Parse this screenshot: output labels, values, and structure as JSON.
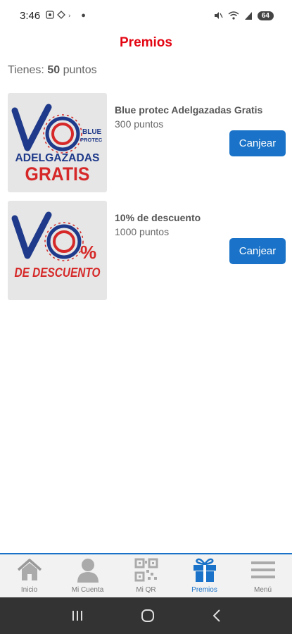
{
  "status": {
    "time": "3:46",
    "battery": "64"
  },
  "header": {
    "title": "Premios"
  },
  "points": {
    "prefix": "Tienes: ",
    "value": "50",
    "suffix": " puntos"
  },
  "rewards": [
    {
      "name": "Blue protec Adelgazadas Gratis",
      "points": "300 puntos",
      "button": "Canjear",
      "image_text": {
        "brand_top": "BLUE",
        "brand_bottom": "PROTEC",
        "line1": "ADELGAZADAS",
        "line2": "GRATIS"
      }
    },
    {
      "name": "10% de descuento",
      "points": "1000 puntos",
      "button": "Canjear",
      "image_text": {
        "percent": "%",
        "line1": "DE DESCUENTO"
      }
    }
  ],
  "nav": {
    "items": [
      {
        "label": "Inicio",
        "icon": "home-icon"
      },
      {
        "label": "Mi Cuenta",
        "icon": "user-icon"
      },
      {
        "label": "Mi QR",
        "icon": "qr-icon"
      },
      {
        "label": "Premios",
        "icon": "gift-icon",
        "active": true
      },
      {
        "label": "Menú",
        "icon": "menu-icon"
      }
    ]
  },
  "colors": {
    "accent": "#1a73c8",
    "title_red": "#e30613",
    "logo_navy": "#1f3a8a",
    "logo_red": "#d62828"
  }
}
